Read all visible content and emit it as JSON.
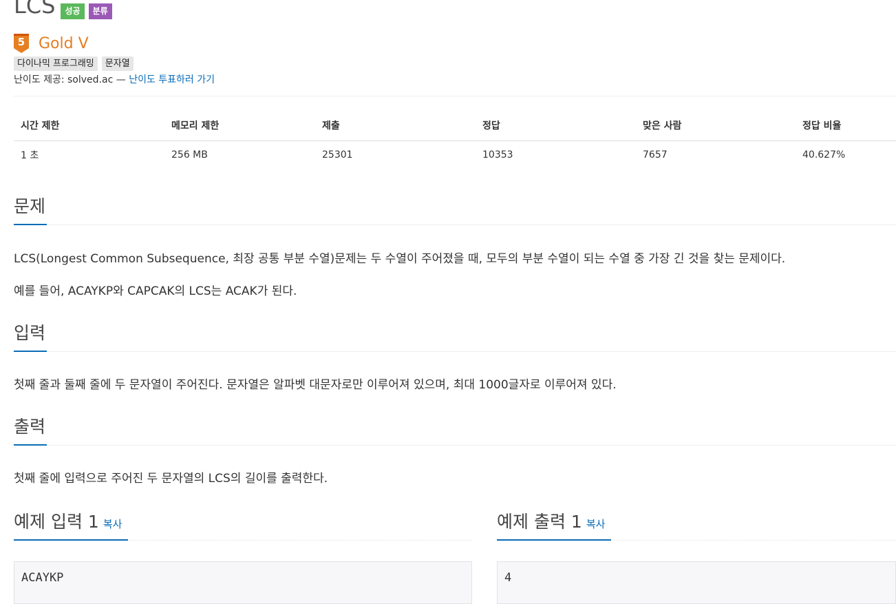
{
  "problem": {
    "title": "LCS",
    "badges": {
      "success": "성공",
      "category": "분류"
    },
    "tier": {
      "number": "5",
      "label": "Gold V",
      "color": "#e67e22"
    },
    "tags": [
      "다이나믹 프로그래밍",
      "문자열"
    ],
    "provider": {
      "prefix": "난이도 제공: solved.ac — ",
      "link": "난이도 투표하러 가기"
    }
  },
  "stats": {
    "headers": [
      "시간 제한",
      "메모리 제한",
      "제출",
      "정답",
      "맞은 사람",
      "정답 비율"
    ],
    "values": [
      "1 초",
      "256 MB",
      "25301",
      "10353",
      "7657",
      "40.627%"
    ]
  },
  "sections": {
    "problem": {
      "title": "문제",
      "paragraphs": [
        "LCS(Longest Common Subsequence, 최장 공통 부분 수열)문제는 두 수열이 주어졌을 때, 모두의 부분 수열이 되는 수열 중 가장 긴 것을 찾는 문제이다.",
        "예를 들어, ACAYKP와 CAPCAK의 LCS는 ACAK가 된다."
      ]
    },
    "input": {
      "title": "입력",
      "text": "첫째 줄과 둘째 줄에 두 문자열이 주어진다. 문자열은 알파벳 대문자로만 이루어져 있으며, 최대 1000글자로 이루어져 있다."
    },
    "output": {
      "title": "출력",
      "text": "첫째 줄에 입력으로 주어진 두 문자열의 LCS의 길이를 출력한다."
    }
  },
  "samples": {
    "input": {
      "title": "예제 입력 1",
      "copy": "복사",
      "content": "ACAYKP"
    },
    "output": {
      "title": "예제 출력 1",
      "copy": "복사",
      "content": "4"
    }
  },
  "colors": {
    "link": "#0a6cb6",
    "success": "#5cb85c",
    "category": "#9b59b6",
    "tag_bg": "#e6e6e6"
  }
}
